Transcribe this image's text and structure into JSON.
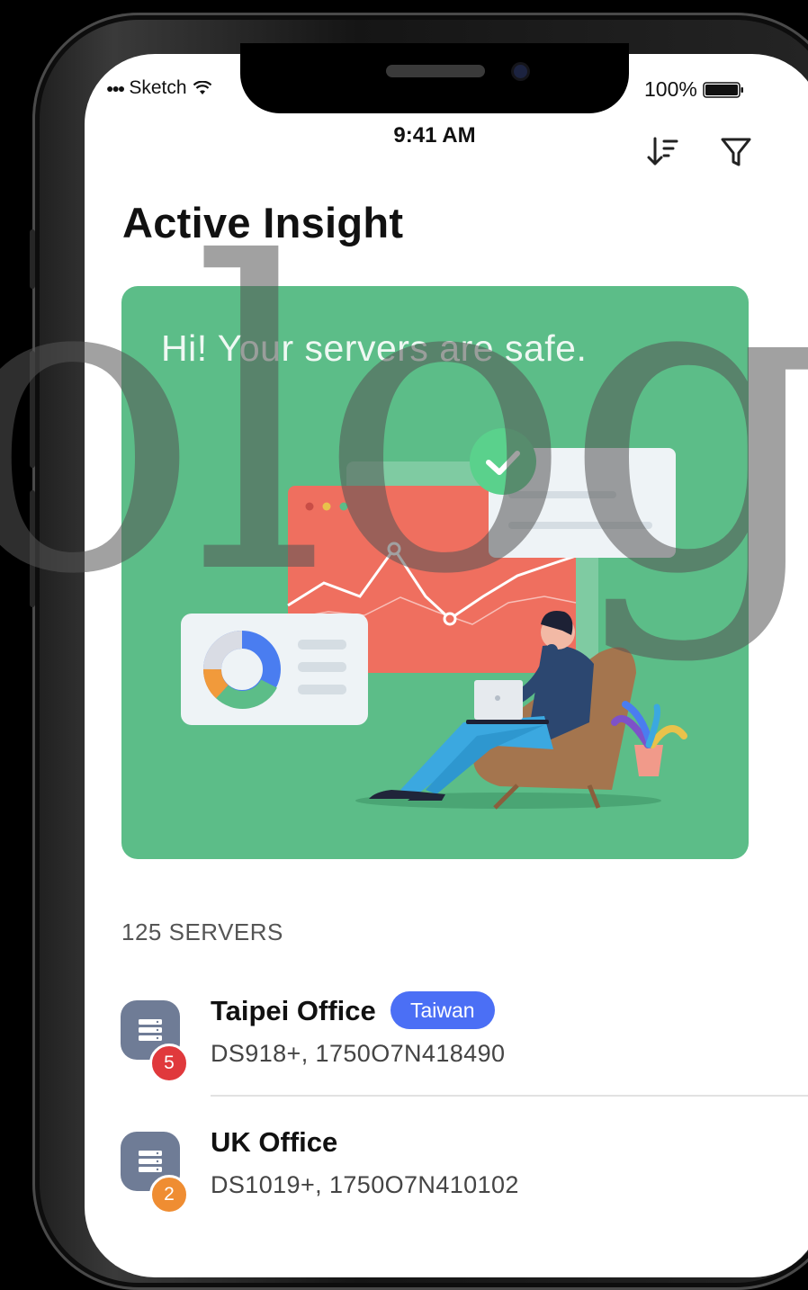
{
  "status_bar": {
    "carrier": "Sketch",
    "time": "9:41 AM",
    "battery": "100%"
  },
  "header": {
    "title": "Active Insight",
    "sort_icon": "sort-descending-icon",
    "filter_icon": "filter-icon"
  },
  "hero": {
    "message": "Hi! Your servers are safe."
  },
  "servers": {
    "count_label": "125 SERVERS",
    "items": [
      {
        "name": "Taipei Office",
        "tag": "Taiwan",
        "detail": "DS918+, 1750O7N418490",
        "badge": "5",
        "badge_color": "#e0393c"
      },
      {
        "name": "UK Office",
        "detail": "DS1019+, 1750O7N410102",
        "badge": "2",
        "badge_color": "#ef8d32"
      }
    ]
  },
  "colors": {
    "hero_green": "#5cbd88",
    "tag_blue": "#4b6ff5",
    "server_icon": "#6f7c96"
  },
  "watermark": {
    "text": "olog"
  }
}
